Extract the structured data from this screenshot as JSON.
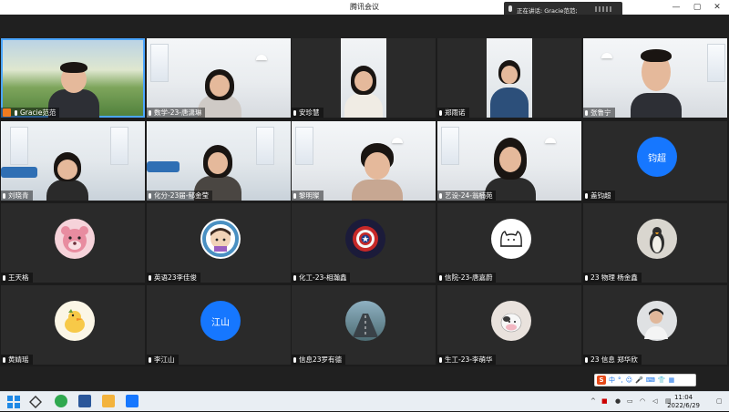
{
  "window": {
    "title": "腾讯会议",
    "controls": [
      "—",
      "▢",
      "✕"
    ]
  },
  "speaking": {
    "label": "正在讲话: Gracie范范;"
  },
  "participants": [
    {
      "name": "Gracie范范",
      "mic": "on",
      "host": true,
      "type": "video"
    },
    {
      "name": "数学-23-唐潇琳",
      "mic": "on",
      "type": "video"
    },
    {
      "name": "安珍慧",
      "mic": "on",
      "type": "video"
    },
    {
      "name": "郑雨诺",
      "mic": "on",
      "type": "video"
    },
    {
      "name": "张鲁宁",
      "mic": "on",
      "type": "video"
    },
    {
      "name": "刘晓青",
      "mic": "on",
      "type": "video"
    },
    {
      "name": "化分-23届-郁金莹",
      "mic": "on",
      "type": "video"
    },
    {
      "name": "黎明璨",
      "mic": "on",
      "type": "video"
    },
    {
      "name": "艺设-24-翁楠苑",
      "mic": "on",
      "type": "video"
    },
    {
      "name": "盖钧超",
      "mic": "on",
      "type": "avatar",
      "avatar_text": "钧超",
      "avatar_color": "#1677ff"
    },
    {
      "name": "王天格",
      "mic": "on",
      "type": "avatar",
      "avatar_icon": "pink-bear-avatar"
    },
    {
      "name": "英语23李佳俊",
      "mic": "on",
      "type": "avatar",
      "avatar_icon": "cartoon-boy-badge-avatar"
    },
    {
      "name": "化工-23-相瀚鑫",
      "mic": "on",
      "type": "avatar",
      "avatar_icon": "captain-america-avatar"
    },
    {
      "name": "信院-23-唐嘉蔚",
      "mic": "on",
      "type": "avatar",
      "avatar_icon": "cat-sketch-avatar"
    },
    {
      "name": "23 物理 杨金鑫",
      "mic": "on",
      "type": "avatar",
      "avatar_icon": "penguin-avatar"
    },
    {
      "name": "黄婧瑶",
      "mic": "on",
      "type": "avatar",
      "avatar_icon": "cartoon-duck-avatar"
    },
    {
      "name": "李江山",
      "mic": "on",
      "type": "avatar",
      "avatar_text": "江山",
      "avatar_color": "#1677ff"
    },
    {
      "name": "信息23罗有德",
      "mic": "on",
      "type": "avatar",
      "avatar_icon": "road-photo-avatar"
    },
    {
      "name": "生工-23-李萌华",
      "mic": "on",
      "type": "avatar",
      "avatar_icon": "cow-toy-avatar"
    },
    {
      "name": "23 信息 郑华欣",
      "mic": "on",
      "type": "avatar",
      "avatar_icon": "person-photo-avatar"
    }
  ],
  "ime": {
    "logo": "S",
    "items": [
      "中",
      "°,",
      "☺",
      "🎤",
      "⌨",
      "👕",
      "▦"
    ]
  },
  "taskbar": {
    "apps": [
      "start-icon",
      "widgets-icon",
      "edge-icon",
      "word-icon",
      "explorer-icon",
      "tencent-meeting-icon"
    ],
    "time": "11:04",
    "date": "2022/6/29"
  },
  "colors": {
    "accent": "#1677ff",
    "active_border": "#4ca6ff",
    "host_badge": "#f07b1f"
  }
}
